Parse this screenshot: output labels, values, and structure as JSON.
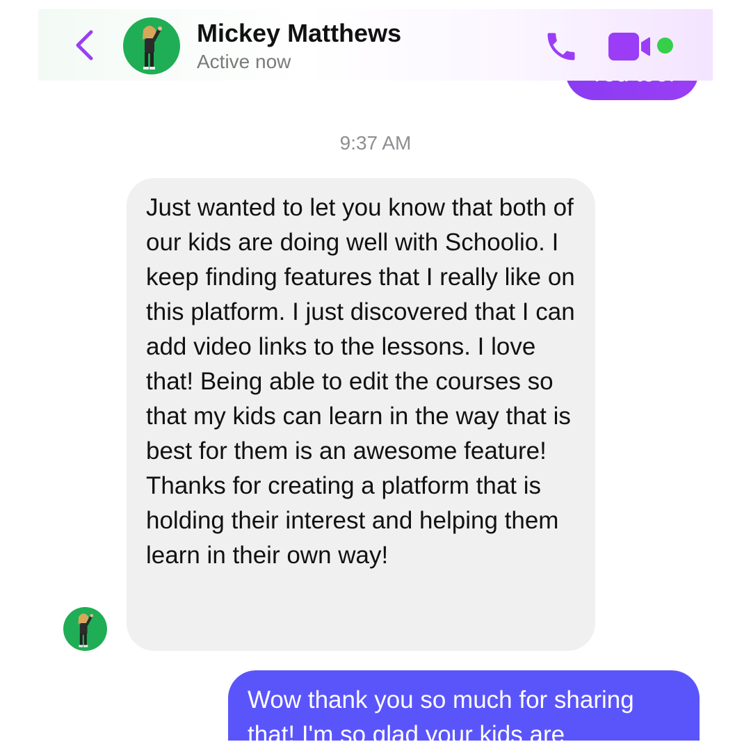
{
  "header": {
    "contact_name": "Mickey Matthews",
    "status": "Active now",
    "back_icon": "chevron-left-icon",
    "call_icon": "phone-icon",
    "video_icon": "video-camera-icon",
    "accent_color": "#9b3df6",
    "online_color": "#35cf4a"
  },
  "messages": {
    "previous_outgoing": "You too!",
    "timestamp": "9:37 AM",
    "incoming_text": "Just wanted to let you know that both of our kids are doing well with Schoolio. I keep finding features that I really like on this platform. I just discovered that I can add video links to the lessons. I love that! Being able to edit the courses so that my kids can learn in the way that is best for them is an awesome feature! Thanks for creating a platform that is holding their interest and helping them learn in their own way!",
    "outgoing_text": "Wow thank you so much for sharing that! I'm so glad your kids are"
  }
}
